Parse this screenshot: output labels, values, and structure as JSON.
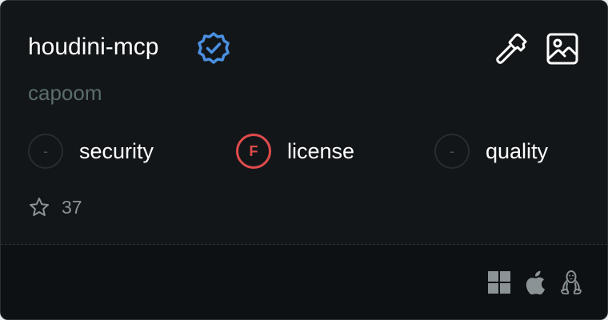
{
  "server": {
    "name": "houdini-mcp",
    "owner": "capoom",
    "verified_icon": "verified-badge-icon"
  },
  "actions": [
    {
      "icon": "hammer-icon",
      "label": "tools"
    },
    {
      "icon": "image-icon",
      "label": "image"
    }
  ],
  "scores": [
    {
      "grade": "-",
      "label": "security"
    },
    {
      "grade": "F",
      "label": "license"
    },
    {
      "grade": "-",
      "label": "quality"
    }
  ],
  "stars": {
    "count": "37",
    "icon": "star-icon"
  },
  "platforms": [
    "windows-icon",
    "apple-icon",
    "linux-icon"
  ],
  "colors": {
    "background": "#121619",
    "accent_verified": "#4a90e2",
    "grade_fail": "#e04b4b",
    "owner_text": "#5b6d6b"
  }
}
